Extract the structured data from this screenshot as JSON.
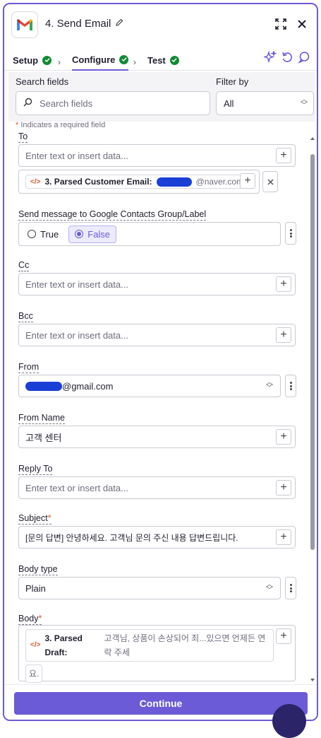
{
  "header": {
    "title": "4. Send Email",
    "app_icon": "gmail-logo",
    "icons": [
      "pencil-icon",
      "expand-icon",
      "close-icon"
    ]
  },
  "tabs": [
    {
      "label": "Setup",
      "status": "complete"
    },
    {
      "label": "Configure",
      "status": "complete"
    },
    {
      "label": "Test",
      "status": "complete"
    }
  ],
  "toolbar_icons": [
    "sparkle-icon",
    "undo-icon",
    "chat-icon"
  ],
  "search": {
    "label": "Search fields",
    "placeholder": "Search fields",
    "filter_label": "Filter by",
    "filter_value": "All"
  },
  "required_note": "Indicates a required field",
  "fields": {
    "to": {
      "label": "To",
      "placeholder": "Enter text or insert data...",
      "pill_step": "3. Parsed Customer Email:",
      "pill_value": "@naver.com"
    },
    "contacts_group": {
      "label": "Send message to Google Contacts Group/Label",
      "options": [
        "True",
        "False"
      ],
      "selected": "False"
    },
    "cc": {
      "label": "Cc",
      "placeholder": "Enter text or insert data..."
    },
    "bcc": {
      "label": "Bcc",
      "placeholder": "Enter text or insert data..."
    },
    "from": {
      "label": "From",
      "value": "@gmail.com"
    },
    "from_name": {
      "label": "From Name",
      "value": "고객 센터"
    },
    "reply_to": {
      "label": "Reply To",
      "placeholder": "Enter text or insert data..."
    },
    "subject": {
      "label": "Subject",
      "value": "[문의 답변] 안녕하세요. 고객님 문의 주신 내용 답변드립니다."
    },
    "body_type": {
      "label": "Body type",
      "value": "Plain"
    },
    "body": {
      "label": "Body",
      "pill_step": "3. Parsed Draft:",
      "pill_value": "고객님, 상품이 손상되어 죄...있으면 언제든 연락 주세",
      "pill_tail": "요."
    }
  },
  "footer": {
    "continue_label": "Continue"
  },
  "colors": {
    "accent": "#6b5bd6",
    "success": "#138a36",
    "required": "#e0582a",
    "redaction": "#1a3fd6"
  }
}
